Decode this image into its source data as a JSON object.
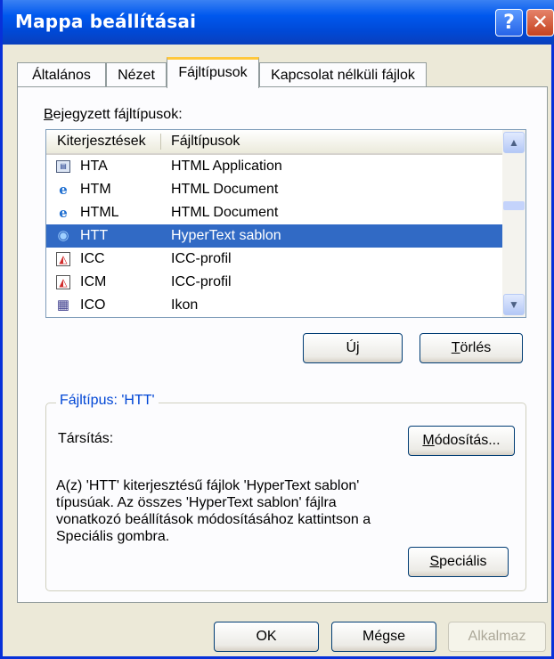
{
  "window": {
    "title": "Mappa beállításai"
  },
  "tabs": [
    {
      "label": "Általános"
    },
    {
      "label": "Nézet"
    },
    {
      "label": "Fájltípusok"
    },
    {
      "label": "Kapcsolat nélküli fájlok"
    }
  ],
  "registered_label": "Bejegyzett fájltípusok:",
  "list": {
    "columns": [
      "Kiterjesztések",
      "Fájltípusok"
    ],
    "rows": [
      {
        "ext": "HTA",
        "type": "HTML Application",
        "icon": "hta-app-icon"
      },
      {
        "ext": "HTM",
        "type": "HTML Document",
        "icon": "ie-document-icon"
      },
      {
        "ext": "HTML",
        "type": "HTML Document",
        "icon": "ie-document-icon"
      },
      {
        "ext": "HTT",
        "type": "HyperText sablon",
        "icon": "hypertext-icon",
        "selected": true
      },
      {
        "ext": "ICC",
        "type": "ICC-profil",
        "icon": "color-profile-icon"
      },
      {
        "ext": "ICM",
        "type": "ICC-profil",
        "icon": "color-profile-icon"
      },
      {
        "ext": "ICO",
        "type": "Ikon",
        "icon": "icon-file-icon"
      }
    ]
  },
  "buttons": {
    "new": "Új",
    "delete": "Törlés",
    "change": "Módosítás...",
    "advanced": "Speciális",
    "ok": "OK",
    "cancel": "Mégse",
    "apply": "Alkalmaz"
  },
  "details": {
    "group_title": "Fájltípus: 'HTT'",
    "opens_with_label": "Társítás:",
    "description": "A(z) 'HTT' kiterjesztésű fájlok 'HyperText sablon' típusúak.  Az összes 'HyperText sablon' fájlra vonatkozó beállítások módosításához kattintson a Speciális gombra."
  },
  "colors": {
    "selection": "#316AC5",
    "titlebar": "#0058EE",
    "group_title": "#0046D5",
    "tab_active_accent": "#FFC83C"
  }
}
